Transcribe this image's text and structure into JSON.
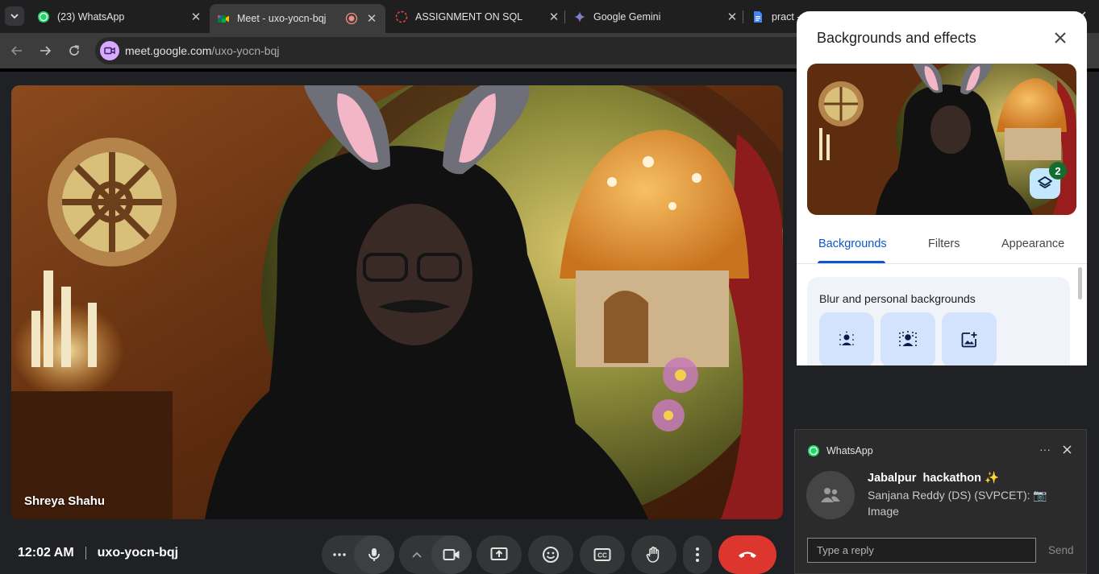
{
  "browser": {
    "tabs": [
      {
        "title": "(23) WhatsApp",
        "icon": "whatsapp-icon"
      },
      {
        "title": "Meet - uxo-yocn-bqj",
        "icon": "google-meet-icon",
        "active": true,
        "recording": true
      },
      {
        "title": "ASSIGNMENT ON SQL",
        "icon": "loading-spinner-icon"
      },
      {
        "title": "Google Gemini",
        "icon": "gemini-icon"
      },
      {
        "title": "pract - Google Docs",
        "icon": "google-docs-icon"
      }
    ],
    "url_domain": "meet.google.com",
    "url_path": "/uxo-yocn-bqj"
  },
  "meet": {
    "participant_name": "Shreya Shahu",
    "time": "12:02 AM",
    "meeting_code": "uxo-yocn-bqj",
    "controls": [
      "more-options",
      "microphone",
      "camera-options",
      "camera",
      "present-screen",
      "reactions",
      "captions",
      "raise-hand",
      "more-vertical",
      "leave-call"
    ],
    "leave_color": "#dc362e"
  },
  "panel": {
    "title": "Backgrounds and effects",
    "effects_count": "2",
    "tabs": [
      "Backgrounds",
      "Filters",
      "Appearance"
    ],
    "active_tab": "Backgrounds",
    "section_title": "Blur and personal backgrounds",
    "options": [
      "slight-blur-icon",
      "blur-icon",
      "add-image-icon"
    ]
  },
  "toast": {
    "app": "WhatsApp",
    "group": "Jabalpur  hackathon ✨",
    "message": "Sanjana Reddy (DS) (SVPCET): 📷 Image",
    "reply_placeholder": "Type a reply",
    "send_label": "Send"
  }
}
